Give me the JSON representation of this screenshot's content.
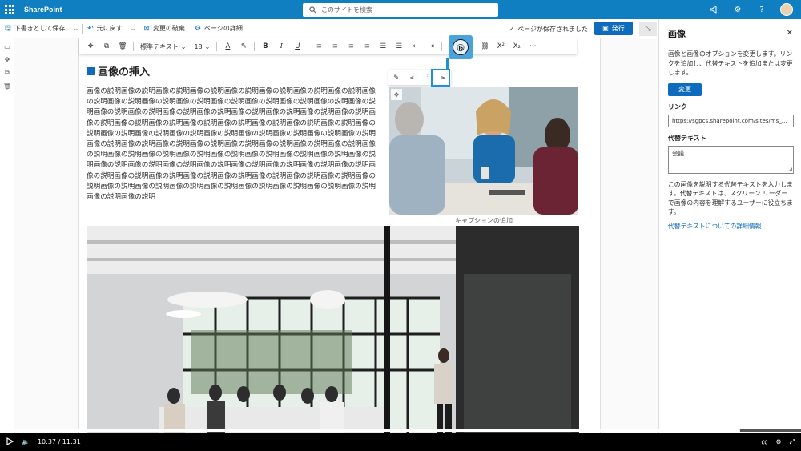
{
  "suite": {
    "brand": "SharePoint",
    "search_placeholder": "このサイトを検索"
  },
  "commandbar": {
    "save_draft": "下書きとして保存",
    "undo": "元に戻す",
    "discard": "変更の破棄",
    "page_details": "ページの詳細",
    "saved_status": "ページが保存されました",
    "publish": "発行"
  },
  "format_toolbar": {
    "style": "標準テキスト",
    "font_size": "18"
  },
  "content": {
    "heading": "画像の挿入",
    "body": "画像の説明画像の説明画像の説明画像の説明画像の説明画像の説明画像の説明画像の説明画像の説明画像の説明画像の説明画像の説明画像の説明画像の説明画像の説明画像の説明画像の説明画像の説明画像の説明画像の説明画像の説明画像の説明画像の説明画像の説明画像の説明画像の説明画像の説明画像の説明画像の説明画像の説明画像の説明画像の説明画像の説明画像の説明画像の説明画像の説明画像の説明画像の説明画像の説明画像の説明画像の説明画像の説明画像の説明画像の説明画像の説明画像の説明画像の説明画像の説明画像の説明画像の説明画像の説明画像の説明画像の説明画像の説明画像の説明画像の説明画像の説明画像の説明画像の説明画像の説明画像の説明画像の説明画像の説明画像の説明画像の説明画像の説明画像の説明画像の説明画像の説明画像の説明画像の説明画像の説明画像の説明画像の説明画像の説明画像の説明画像の説明画像の説明画像の説明画像の説明画像の説明画像の説明画像の説明画像の説明画像の説明画像の説明",
    "caption": "キャプションの追加",
    "callout_number": "⑯"
  },
  "pane": {
    "title": "画像",
    "description": "画像と画像のオプションを変更します。リンクを追加し、代替テキストを追加または変更します。",
    "change_button": "変更",
    "link_label": "リンク",
    "link_value": "https://sgpcs.sharepoint.com/sites/ms_navi/...",
    "alt_label": "代替テキスト",
    "alt_value": "会議",
    "alt_help": "この画像を説明する代替テキストを入力します。代替テキストは、スクリーン リーダーで画像の内容を理解するユーザーに役立ちます。",
    "alt_link": "代替テキストについての詳細情報"
  },
  "video": {
    "time": "10:37 / 11:31",
    "progress": 0.92
  },
  "colors": {
    "suitebar": "#0f7fc2",
    "accent": "#0f6cbd",
    "callout": "#4aa3dd"
  }
}
